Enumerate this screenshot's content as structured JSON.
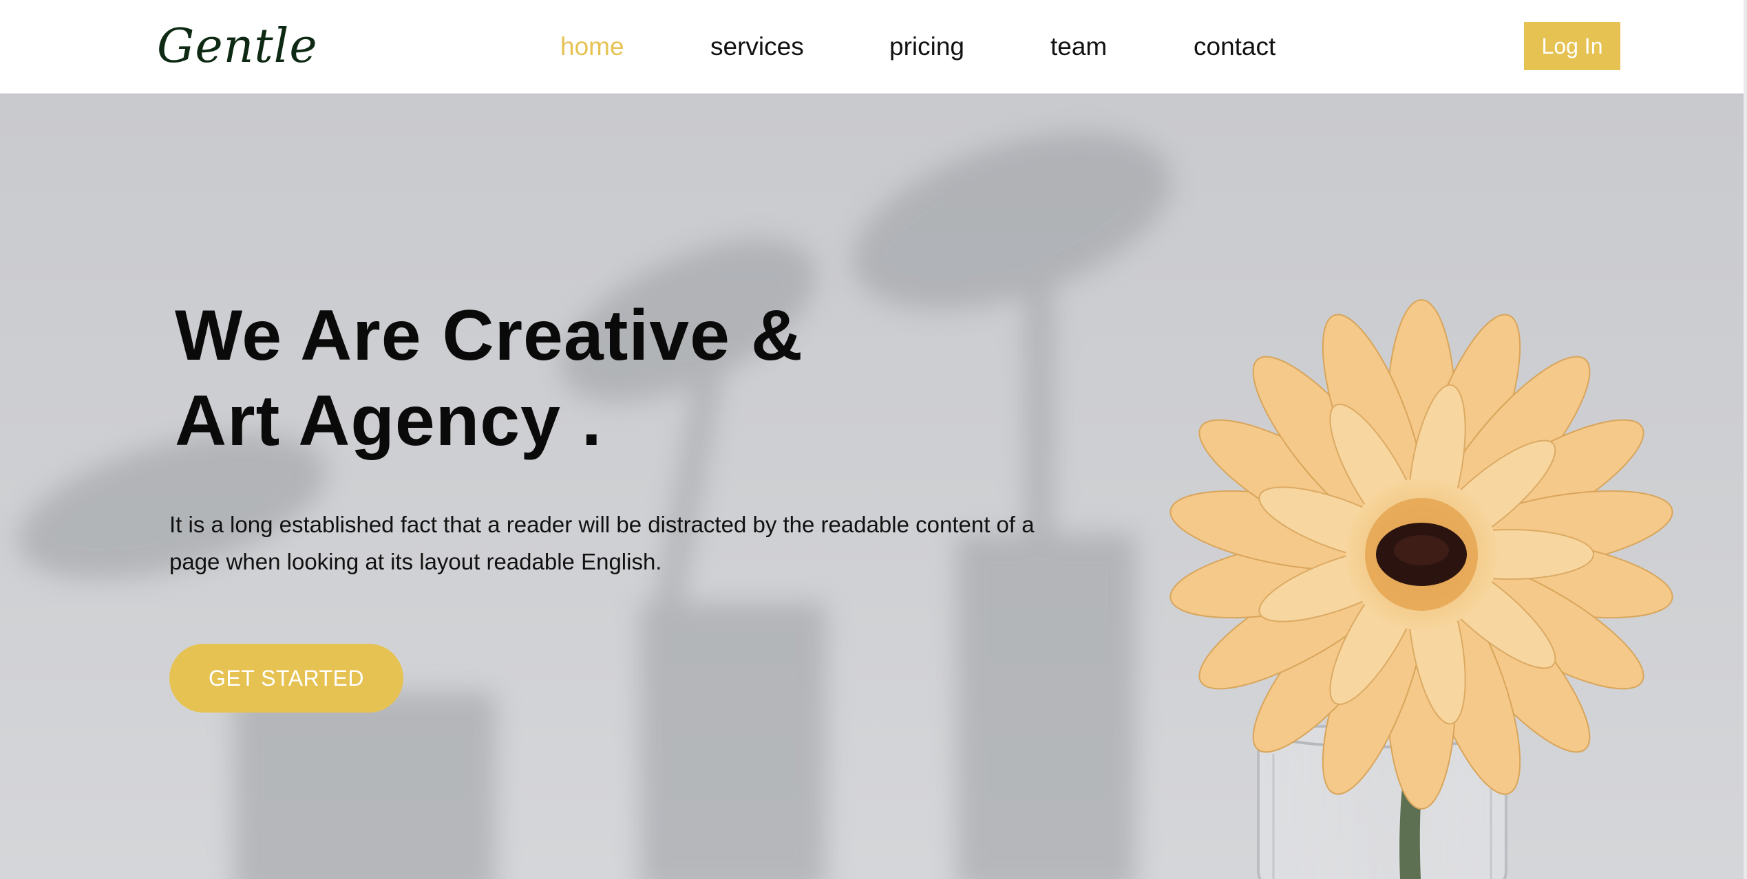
{
  "header": {
    "logo_text": "Gentle",
    "nav": [
      {
        "label": "home",
        "active": true
      },
      {
        "label": "services",
        "active": false
      },
      {
        "label": "pricing",
        "active": false
      },
      {
        "label": "team",
        "active": false
      },
      {
        "label": "contact",
        "active": false
      }
    ],
    "login_label": "Log In"
  },
  "hero": {
    "title_line1": "We Are Creative &",
    "title_line2": "Art Agency .",
    "description": "It is a long established fact that a reader will be distracted by the readable content of a page when looking at its layout readable English.",
    "cta_label": "GET STARTED",
    "image_subject": "orange-gerbera-flower-in-glass-vase"
  },
  "colors": {
    "accent": "#e6c253",
    "logo": "#0f2a14",
    "text": "#111111",
    "hero_background": "#cccdd0",
    "flower": "#f2c47e"
  },
  "icons": {
    "hero_image": "flower-vase-photo"
  }
}
